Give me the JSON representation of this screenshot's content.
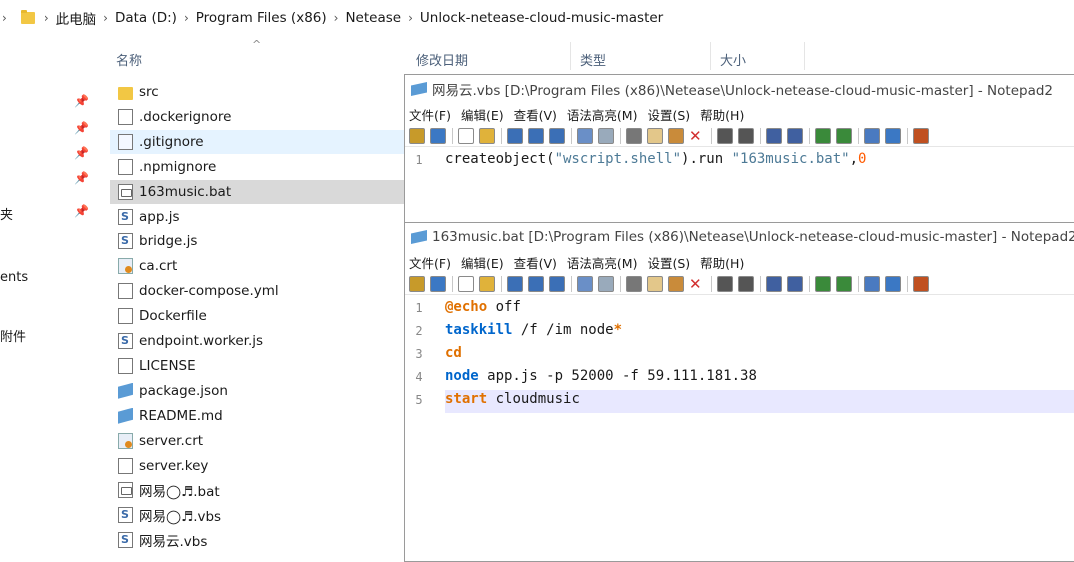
{
  "breadcrumb": {
    "items": [
      "此电脑",
      "Data (D:)",
      "Program Files (x86)",
      "Netease",
      "Unlock-netease-cloud-music-master"
    ]
  },
  "nav": {
    "fragments": [
      "夹",
      "ents",
      "附件"
    ]
  },
  "file_list": {
    "column_name": "名称",
    "columns": [
      "修改日期",
      "类型",
      "大小"
    ],
    "files": [
      {
        "name": "src",
        "icon": "folder-icon"
      },
      {
        "name": ".dockerignore",
        "icon": "file-icon"
      },
      {
        "name": ".gitignore",
        "icon": "file-icon"
      },
      {
        "name": ".npmignore",
        "icon": "file-icon"
      },
      {
        "name": "163music.bat",
        "icon": "batch-file-icon"
      },
      {
        "name": "app.js",
        "icon": "script-icon"
      },
      {
        "name": "bridge.js",
        "icon": "script-icon"
      },
      {
        "name": "ca.crt",
        "icon": "certificate-icon"
      },
      {
        "name": "docker-compose.yml",
        "icon": "file-icon"
      },
      {
        "name": "Dockerfile",
        "icon": "file-icon"
      },
      {
        "name": "endpoint.worker.js",
        "icon": "script-icon"
      },
      {
        "name": "LICENSE",
        "icon": "file-icon"
      },
      {
        "name": "package.json",
        "icon": "notepad2-file-icon"
      },
      {
        "name": "README.md",
        "icon": "notepad2-file-icon"
      },
      {
        "name": "server.crt",
        "icon": "certificate-icon"
      },
      {
        "name": "server.key",
        "icon": "file-icon"
      },
      {
        "name": "网易◯♬.bat",
        "icon": "batch-file-icon"
      },
      {
        "name": "网易◯♬.vbs",
        "icon": "script-icon"
      },
      {
        "name": "网易云.vbs",
        "icon": "script-icon"
      }
    ]
  },
  "notepad_vbs": {
    "title": "网易云.vbs [D:\\Program Files (x86)\\Netease\\Unlock-netease-cloud-music-master] - Notepad2",
    "menu": [
      "文件(F)",
      "编辑(E)",
      "查看(V)",
      "语法高亮(M)",
      "设置(S)",
      "帮助(H)"
    ],
    "lines": [
      {
        "num": "1",
        "parts": [
          "createobject(",
          "\"wscript.shell\"",
          ").run ",
          "\"163music.bat\"",
          ",",
          "0"
        ]
      }
    ]
  },
  "notepad_bat": {
    "title": "163music.bat [D:\\Program Files (x86)\\Netease\\Unlock-netease-cloud-music-master] - Notepad2",
    "menu": [
      "文件(F)",
      "编辑(E)",
      "查看(V)",
      "语法高亮(M)",
      "设置(S)",
      "帮助(H)"
    ],
    "lines": [
      {
        "num": "1",
        "kw": "@echo",
        "rest": " off"
      },
      {
        "num": "2",
        "kw": "taskkill",
        "rest": " /f /im node",
        "tail": "*"
      },
      {
        "num": "3",
        "kw": "cd",
        "rest": ""
      },
      {
        "num": "4",
        "kw": "node",
        "rest": " app.js -p 52000 -f 59.111.181.38"
      },
      {
        "num": "5",
        "kw": "start",
        "rest": " cloudmusic"
      }
    ]
  },
  "colors": {
    "keyword": "#0066cc",
    "at_keyword": "#e07000",
    "number": "#ff5a00",
    "selected_row": "#d9d9d9",
    "hover_row": "#e5f3ff"
  }
}
